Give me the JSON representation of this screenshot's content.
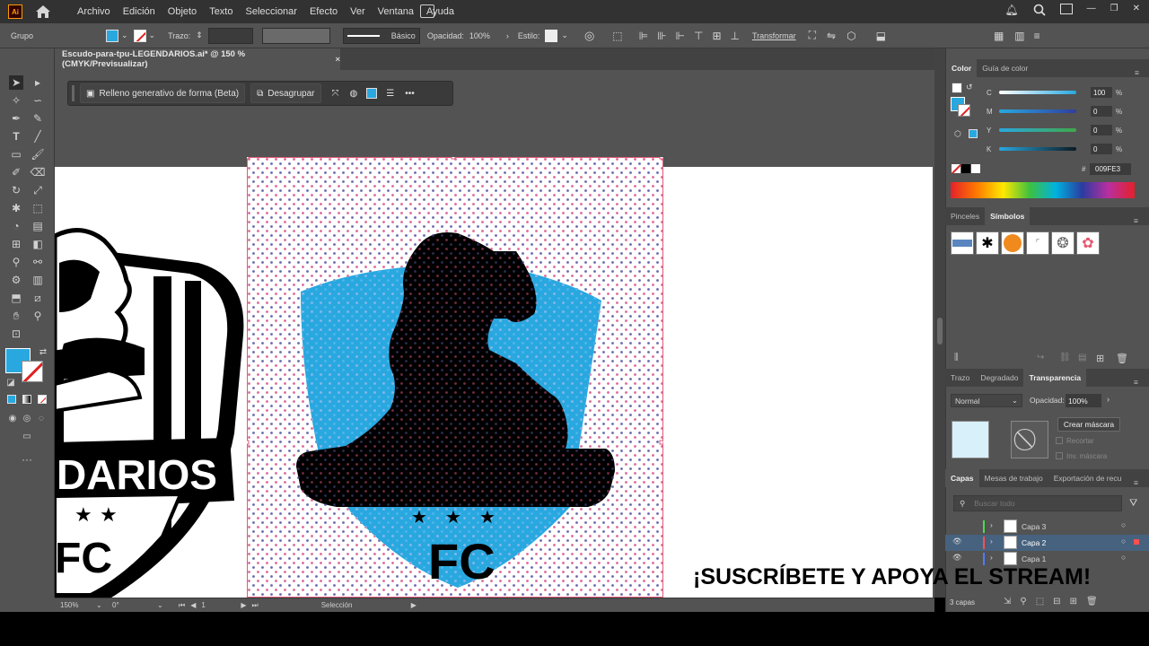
{
  "menubar": {
    "logo": "Ai",
    "items": [
      "Archivo",
      "Edición",
      "Objeto",
      "Texto",
      "Seleccionar",
      "Efecto",
      "Ver",
      "Ventana",
      "Ayuda"
    ]
  },
  "controlbar": {
    "selection_label": "Grupo",
    "stroke_label": "Trazo:",
    "brush_label": "Básico",
    "opacity_label": "Opacidad:",
    "opacity_value": "100%",
    "style_label": "Estilo:",
    "transform_label": "Transformar",
    "fill_color": "#29a8e0"
  },
  "document": {
    "tab_title": "Escudo-para-tpu-LEGENDARIOS.ai* @ 150 % (CMYK/Previsualizar)",
    "close_glyph": "×"
  },
  "context_bar": {
    "generative_fill": "Relleno generativo de forma (Beta)",
    "ungroup": "Desagrupar"
  },
  "artwork": {
    "left_logo_text": "DARIOS",
    "left_logo_fc": "FC",
    "shield_fc": "FC",
    "shield_color": "#29a8e0"
  },
  "color_panel": {
    "tabs": [
      "Color",
      "Guía de color"
    ],
    "channels": [
      {
        "label": "C",
        "value": "100",
        "unit": "%"
      },
      {
        "label": "M",
        "value": "0",
        "unit": "%"
      },
      {
        "label": "Y",
        "value": "0",
        "unit": "%"
      },
      {
        "label": "K",
        "value": "0",
        "unit": "%"
      }
    ],
    "hex_prefix": "#",
    "hex_value": "009FE3"
  },
  "symbols_panel": {
    "tabs": [
      "Pinceles",
      "Símbolos"
    ]
  },
  "transparency_panel": {
    "tabs": [
      "Trazo",
      "Degradado",
      "Transparencia"
    ],
    "blend_mode": "Normal",
    "opacity_label": "Opacidad:",
    "opacity_value": "100%",
    "make_mask": "Crear máscara",
    "clip": "Recortar",
    "invert_mask": "Inv. máscara"
  },
  "layers_panel": {
    "tabs": [
      "Capas",
      "Mesas de trabajo",
      "Exportación de recu"
    ],
    "search_placeholder": "Buscar todo",
    "layers": [
      {
        "name": "Capa 3",
        "color": "#4cd94c",
        "visible": false
      },
      {
        "name": "Capa 2",
        "color": "#ff4f4f",
        "visible": true
      },
      {
        "name": "Capa 1",
        "color": "#4f7bff",
        "visible": true
      }
    ],
    "count": "3 capas"
  },
  "statusbar": {
    "zoom": "150%",
    "rotation": "0°",
    "artboard": "1",
    "tool": "Selección"
  },
  "overlay_text": "¡SUSCRÍBETE Y APOYA EL STREAM!"
}
